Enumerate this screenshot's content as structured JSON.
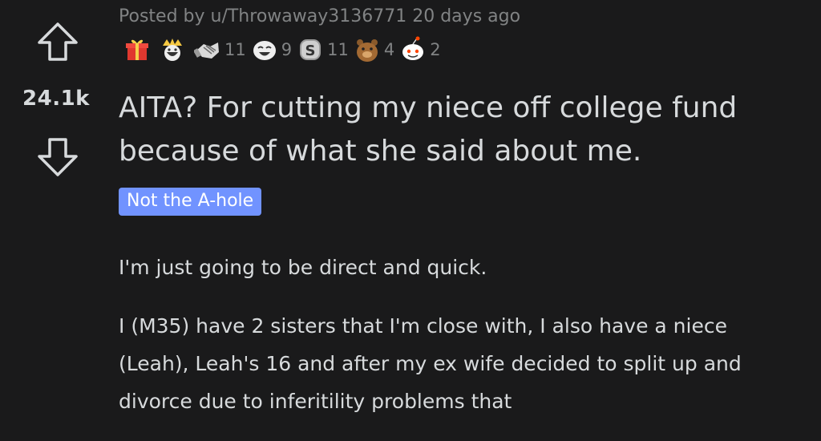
{
  "post": {
    "score": "24.1k",
    "meta_prefix": "Posted by",
    "author": "u/Throwaway3136771",
    "age": "20 days ago",
    "title": "AITA? For cutting my niece off college fund because of what she said about me.",
    "flair": "Not the A-hole",
    "paragraphs": [
      "I'm just going to be direct and quick.",
      "I (M35) have 2 sisters that I'm close with, I also have a niece (Leah), Leah's 16 and after my ex wife decided to split up and divorce due to inferitility problems that"
    ]
  },
  "awards": [
    {
      "icon": "gift-award-icon",
      "count": ""
    },
    {
      "icon": "crown-laugh-award-icon",
      "count": ""
    },
    {
      "icon": "handshake-award-icon",
      "count": "11"
    },
    {
      "icon": "laughing-face-award-icon",
      "count": "9"
    },
    {
      "icon": "silver-s-award-icon",
      "count": "11"
    },
    {
      "icon": "bear-award-icon",
      "count": "4"
    },
    {
      "icon": "snoo-award-icon",
      "count": "2"
    }
  ],
  "colors": {
    "background": "#1a1a1b",
    "text": "#d7dadc",
    "muted": "#818384",
    "flair_bg": "#7193ff"
  }
}
